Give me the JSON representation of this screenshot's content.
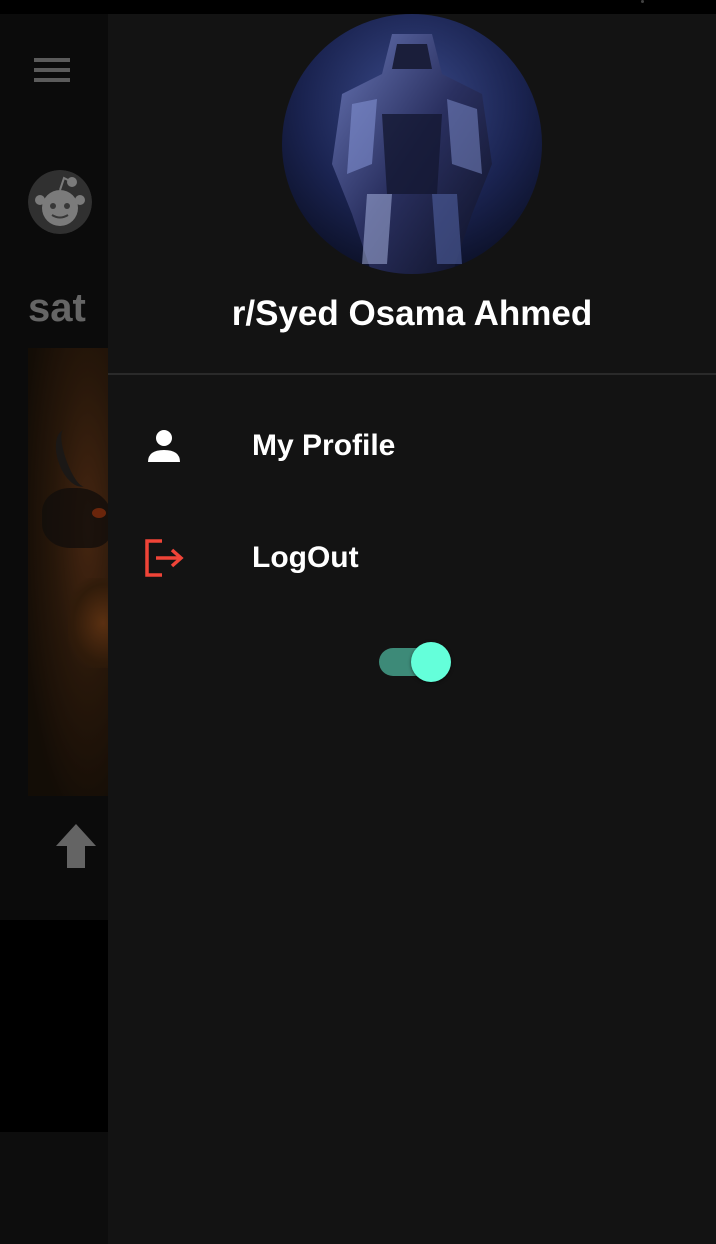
{
  "drawer": {
    "username": "r/Syed Osama Ahmed",
    "items": [
      {
        "label": "My Profile",
        "icon": "person-icon"
      },
      {
        "label": "LogOut",
        "icon": "logout-icon"
      }
    ],
    "toggle": {
      "on": true,
      "accent": "#64ffda"
    }
  },
  "background": {
    "title": "sat",
    "menu_icon": "hamburger-icon",
    "vote_icon": "upvote-arrow-icon"
  },
  "colors": {
    "drawer_bg": "#131313",
    "logout_accent": "#f04438",
    "text": "#ffffff"
  }
}
